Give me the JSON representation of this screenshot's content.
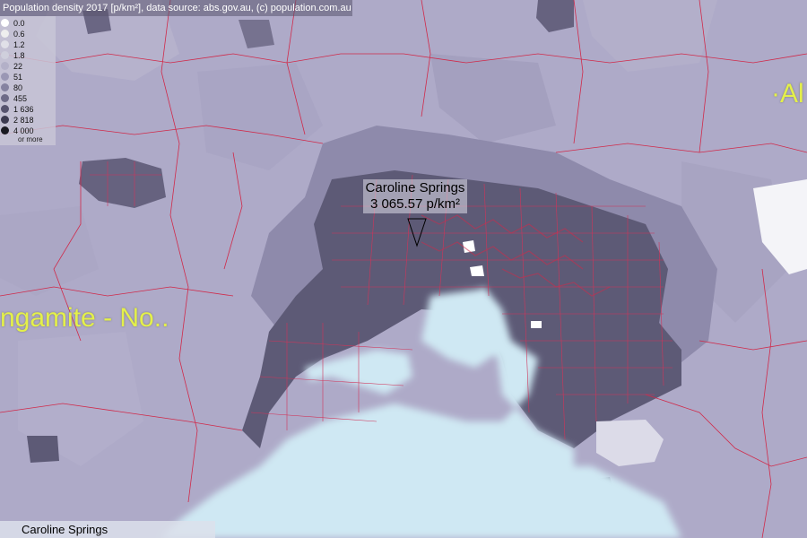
{
  "header": {
    "title": "Population density 2017 [p/km²], data source: abs.gov.au, (c) population.com.au"
  },
  "legend": {
    "items": [
      {
        "label": "0.0",
        "color": "#ffffff"
      },
      {
        "label": "0.6",
        "color": "#eeeeee"
      },
      {
        "label": "1.2",
        "color": "#e0e0e8"
      },
      {
        "label": "1.8",
        "color": "#cfcfdc"
      },
      {
        "label": "22",
        "color": "#b3b0c8"
      },
      {
        "label": "51",
        "color": "#9a97b4"
      },
      {
        "label": "80",
        "color": "#8582a0"
      },
      {
        "label": "455",
        "color": "#6e6b88"
      },
      {
        "label": "1 636",
        "color": "#56536e"
      },
      {
        "label": "2 818",
        "color": "#3c3a50"
      },
      {
        "label": "4 000",
        "color": "#1a1a22"
      }
    ],
    "more": "or more"
  },
  "callout": {
    "name": "Caroline Springs",
    "value": "3 065.57 p/km²"
  },
  "labels": {
    "left_region": "ngamite - No..",
    "right_region": "·Al"
  },
  "status_bar": {
    "location": "Caroline Springs"
  },
  "colors": {
    "rural": "#aeaac8",
    "urban": "#5d5a76",
    "suburban": "#8a86a6",
    "water": "#cfe8f3",
    "boundary": "#d02a4a",
    "label": "#e4f04a"
  }
}
